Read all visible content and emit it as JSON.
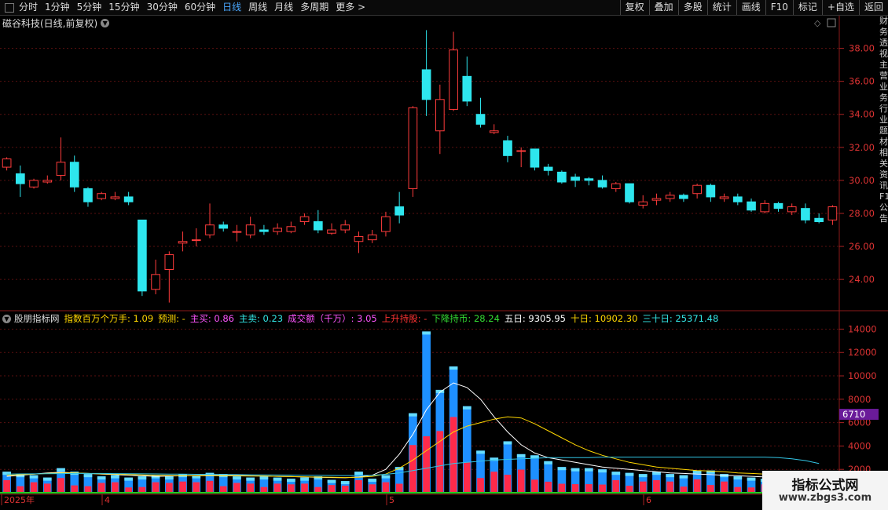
{
  "toolbar": {
    "periods": [
      "分时",
      "1分钟",
      "5分钟",
      "15分钟",
      "30分钟",
      "60分钟",
      "日线",
      "周线",
      "月线",
      "多周期",
      "更多 >"
    ],
    "active_period": "日线",
    "right_buttons": [
      "复权",
      "叠加",
      "多股",
      "统计",
      "画线",
      "F10",
      "标记",
      "+自选",
      "返回"
    ]
  },
  "kline_header": {
    "title": "磁谷科技(日线,前复权)"
  },
  "indicator_line": {
    "name": "股朋指标网",
    "items": [
      {
        "text": "指数百万个万手: 1.09",
        "color": "#ffd700"
      },
      {
        "text": "预测: -",
        "color": "#ffd700"
      },
      {
        "text": "主买: 0.86",
        "color": "#ff55ff"
      },
      {
        "text": "主卖: 0.23",
        "color": "#33e6e6"
      },
      {
        "text": "成交额（千万）: 3.05",
        "color": "#ff55ff"
      },
      {
        "text": "上升持股: -",
        "color": "#ff3333"
      },
      {
        "text": "下降持币: 28.24",
        "color": "#33dd33"
      },
      {
        "text": "五日: 9305.95",
        "color": "#ffffff"
      },
      {
        "text": "十日: 10902.30",
        "color": "#ffd700"
      },
      {
        "text": "三十日: 25371.48",
        "color": "#33e6e6"
      }
    ]
  },
  "price_axis": {
    "ticks": [
      "38.00",
      "36.00",
      "34.00",
      "32.00",
      "30.00",
      "28.00",
      "26.00",
      "24.00"
    ]
  },
  "volume_axis": {
    "ticks": [
      "14000",
      "12000",
      "10000",
      "8000",
      "6000",
      "4000",
      "2000"
    ],
    "current_label": "6710"
  },
  "date_labels": [
    "2025年",
    "4",
    "5",
    "6"
  ],
  "side_text": [
    "财",
    "务",
    "透",
    "视",
    "主",
    "营",
    "业",
    "务",
    "行",
    "业",
    "题",
    "材",
    "相",
    "关",
    "资",
    "讯",
    "F10",
    "公",
    "告"
  ],
  "watermark": {
    "line1": "指标公式网",
    "line2": "www.zbgs3.com"
  },
  "chart_data": [
    {
      "type": "candlestick",
      "title": "磁谷科技(日线,前复权)",
      "ylim": [
        22.5,
        39.5
      ],
      "candles": [
        {
          "o": 30.8,
          "c": 31.3,
          "h": 31.4,
          "l": 30.6
        },
        {
          "o": 30.4,
          "c": 29.8,
          "h": 30.9,
          "l": 29.0
        },
        {
          "o": 29.6,
          "c": 30.0,
          "h": 30.1,
          "l": 29.5
        },
        {
          "o": 29.9,
          "c": 30.0,
          "h": 30.3,
          "l": 29.8
        },
        {
          "o": 30.3,
          "c": 31.1,
          "h": 32.6,
          "l": 30.0
        },
        {
          "o": 31.1,
          "c": 29.6,
          "h": 31.5,
          "l": 29.3
        },
        {
          "o": 29.5,
          "c": 28.7,
          "h": 29.6,
          "l": 28.4
        },
        {
          "o": 28.9,
          "c": 29.2,
          "h": 29.3,
          "l": 28.8
        },
        {
          "o": 28.9,
          "c": 29.0,
          "h": 29.3,
          "l": 28.8
        },
        {
          "o": 29.0,
          "c": 28.7,
          "h": 29.3,
          "l": 28.5
        },
        {
          "o": 27.6,
          "c": 23.3,
          "h": 27.6,
          "l": 23.0
        },
        {
          "o": 23.4,
          "c": 24.3,
          "h": 25.2,
          "l": 23.1
        },
        {
          "o": 24.6,
          "c": 25.5,
          "h": 25.7,
          "l": 22.6
        },
        {
          "o": 26.2,
          "c": 26.3,
          "h": 26.9,
          "l": 25.7
        },
        {
          "o": 26.4,
          "c": 26.4,
          "h": 27.1,
          "l": 26.0
        },
        {
          "o": 26.7,
          "c": 27.3,
          "h": 28.6,
          "l": 26.5
        },
        {
          "o": 27.3,
          "c": 27.1,
          "h": 27.5,
          "l": 26.9
        },
        {
          "o": 26.9,
          "c": 26.9,
          "h": 27.3,
          "l": 26.3
        },
        {
          "o": 26.7,
          "c": 27.3,
          "h": 27.8,
          "l": 26.5
        },
        {
          "o": 27.0,
          "c": 26.9,
          "h": 27.3,
          "l": 26.7
        },
        {
          "o": 26.9,
          "c": 27.1,
          "h": 27.4,
          "l": 26.7
        },
        {
          "o": 26.9,
          "c": 27.2,
          "h": 27.5,
          "l": 26.8
        },
        {
          "o": 27.5,
          "c": 27.8,
          "h": 28.0,
          "l": 27.3
        },
        {
          "o": 27.5,
          "c": 27.0,
          "h": 28.2,
          "l": 26.8
        },
        {
          "o": 26.8,
          "c": 27.0,
          "h": 27.4,
          "l": 26.7
        },
        {
          "o": 27.0,
          "c": 27.3,
          "h": 27.6,
          "l": 26.8
        },
        {
          "o": 26.3,
          "c": 26.6,
          "h": 26.9,
          "l": 25.6
        },
        {
          "o": 26.4,
          "c": 26.7,
          "h": 27.0,
          "l": 26.2
        },
        {
          "o": 26.9,
          "c": 27.8,
          "h": 28.1,
          "l": 26.6
        },
        {
          "o": 28.4,
          "c": 27.9,
          "h": 29.3,
          "l": 27.4
        },
        {
          "o": 29.5,
          "c": 34.4,
          "h": 34.5,
          "l": 29.0
        },
        {
          "o": 36.7,
          "c": 34.9,
          "h": 39.1,
          "l": 33.9
        },
        {
          "o": 33.0,
          "c": 34.9,
          "h": 35.8,
          "l": 31.6
        },
        {
          "o": 34.3,
          "c": 37.9,
          "h": 39.0,
          "l": 34.2
        },
        {
          "o": 36.3,
          "c": 34.8,
          "h": 37.5,
          "l": 34.5
        },
        {
          "o": 34.0,
          "c": 33.4,
          "h": 35.0,
          "l": 33.2
        },
        {
          "o": 32.9,
          "c": 33.0,
          "h": 33.4,
          "l": 32.8
        },
        {
          "o": 32.4,
          "c": 31.5,
          "h": 32.7,
          "l": 31.1
        },
        {
          "o": 31.8,
          "c": 31.8,
          "h": 32.0,
          "l": 30.8
        },
        {
          "o": 31.9,
          "c": 30.8,
          "h": 31.9,
          "l": 30.6
        },
        {
          "o": 30.8,
          "c": 30.6,
          "h": 31.0,
          "l": 30.3
        },
        {
          "o": 30.5,
          "c": 29.9,
          "h": 30.6,
          "l": 29.8
        },
        {
          "o": 30.2,
          "c": 30.0,
          "h": 30.4,
          "l": 29.6
        },
        {
          "o": 30.1,
          "c": 30.0,
          "h": 30.2,
          "l": 29.7
        },
        {
          "o": 30.0,
          "c": 29.6,
          "h": 30.3,
          "l": 29.5
        },
        {
          "o": 29.5,
          "c": 29.8,
          "h": 29.9,
          "l": 29.3
        },
        {
          "o": 29.8,
          "c": 28.7,
          "h": 29.8,
          "l": 28.6
        },
        {
          "o": 28.5,
          "c": 28.7,
          "h": 29.1,
          "l": 28.3
        },
        {
          "o": 28.8,
          "c": 28.9,
          "h": 29.2,
          "l": 28.5
        },
        {
          "o": 28.9,
          "c": 29.1,
          "h": 29.3,
          "l": 28.7
        },
        {
          "o": 29.1,
          "c": 28.9,
          "h": 29.2,
          "l": 28.7
        },
        {
          "o": 29.2,
          "c": 29.7,
          "h": 29.8,
          "l": 28.9
        },
        {
          "o": 29.7,
          "c": 29.0,
          "h": 29.8,
          "l": 28.7
        },
        {
          "o": 28.9,
          "c": 29.0,
          "h": 29.2,
          "l": 28.7
        },
        {
          "o": 29.0,
          "c": 28.7,
          "h": 29.2,
          "l": 28.5
        },
        {
          "o": 28.7,
          "c": 28.2,
          "h": 28.9,
          "l": 28.1
        },
        {
          "o": 28.1,
          "c": 28.6,
          "h": 28.8,
          "l": 28.0
        },
        {
          "o": 28.6,
          "c": 28.3,
          "h": 28.7,
          "l": 28.1
        },
        {
          "o": 28.1,
          "c": 28.4,
          "h": 28.6,
          "l": 27.9
        },
        {
          "o": 28.3,
          "c": 27.6,
          "h": 28.6,
          "l": 27.4
        },
        {
          "o": 27.7,
          "c": 27.5,
          "h": 28.0,
          "l": 27.4
        },
        {
          "o": 27.6,
          "c": 28.4,
          "h": 28.5,
          "l": 27.3
        }
      ]
    },
    {
      "type": "bar",
      "title": "股朋指标网",
      "ylim": [
        0,
        14500
      ],
      "values": [
        1800,
        1600,
        1500,
        1300,
        2100,
        1800,
        1600,
        1400,
        1500,
        1300,
        1400,
        1500,
        1400,
        1600,
        1500,
        1700,
        1600,
        1400,
        1300,
        1400,
        1300,
        1200,
        1300,
        1400,
        1100,
        1000,
        1800,
        1200,
        1500,
        2200,
        6800,
        13800,
        8800,
        10800,
        7400,
        3600,
        3000,
        4400,
        3300,
        3200,
        2700,
        2200,
        2100,
        2100,
        2000,
        1800,
        1700,
        1600,
        1800,
        1600,
        1500,
        1900,
        1900,
        1600,
        1400,
        1300,
        1200,
        1200,
        1100,
        1000,
        900
      ],
      "series": [
        {
          "name": "五日",
          "values": [
            1400,
            1500,
            1600,
            1700,
            1750,
            1700,
            1650,
            1600,
            1550,
            1500,
            1450,
            1400,
            1420,
            1450,
            1480,
            1500,
            1500,
            1480,
            1450,
            1420,
            1400,
            1380,
            1350,
            1330,
            1300,
            1280,
            1350,
            1500,
            2000,
            3300,
            5000,
            7100,
            8600,
            9400,
            9000,
            8000,
            6500,
            5200,
            4100,
            3400,
            3000,
            2800,
            2600,
            2400,
            2200,
            2100,
            2000,
            1900,
            1800,
            1700,
            1650,
            1600,
            1550,
            1500,
            1450,
            1400,
            1350,
            1300,
            1280,
            1250,
            1250
          ]
        },
        {
          "name": "十日",
          "values": [
            1500,
            1550,
            1600,
            1650,
            1700,
            1700,
            1650,
            1620,
            1600,
            1560,
            1530,
            1500,
            1480,
            1460,
            1450,
            1450,
            1450,
            1440,
            1430,
            1420,
            1400,
            1380,
            1360,
            1340,
            1320,
            1300,
            1320,
            1400,
            1600,
            2100,
            2800,
            3600,
            4400,
            5200,
            5700,
            6000,
            6300,
            6500,
            6400,
            5900,
            5300,
            4700,
            4100,
            3600,
            3200,
            2900,
            2600,
            2400,
            2200,
            2100,
            2000,
            1900,
            1850,
            1800,
            1700,
            1650,
            1600,
            1550,
            1500,
            1480,
            1450
          ]
        },
        {
          "name": "三十日",
          "values": [
            1600,
            1610,
            1620,
            1630,
            1640,
            1650,
            1650,
            1650,
            1640,
            1630,
            1620,
            1610,
            1600,
            1590,
            1580,
            1570,
            1560,
            1550,
            1540,
            1530,
            1520,
            1510,
            1500,
            1490,
            1480,
            1470,
            1480,
            1500,
            1580,
            1700,
            1900,
            2100,
            2300,
            2500,
            2600,
            2700,
            2800,
            2850,
            2900,
            2950,
            3000,
            3000,
            3000,
            3000,
            3050,
            3050,
            3050,
            3050,
            3050,
            3050,
            3050,
            3050,
            3050,
            3050,
            3050,
            3050,
            3050,
            3000,
            2900,
            2750,
            2500
          ]
        }
      ]
    }
  ]
}
